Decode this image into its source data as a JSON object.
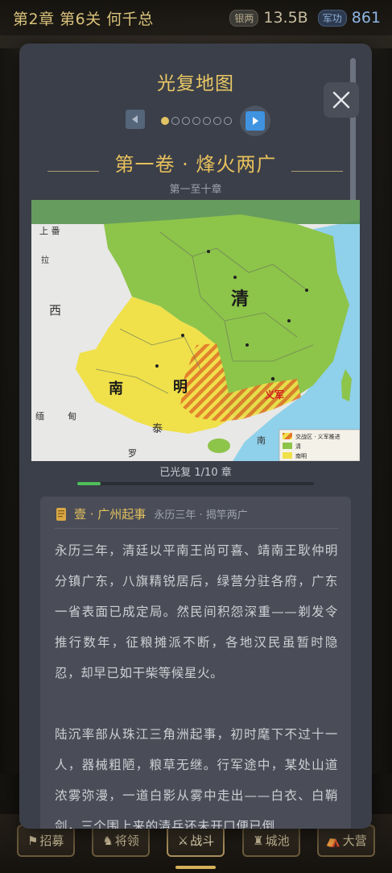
{
  "topbar": {
    "chapter": "第2章 第6关 何千总",
    "silver_label": "银两",
    "silver_value": "13.5B",
    "merit_label": "军功",
    "merit_value": "861"
  },
  "modal": {
    "title": "光复地图",
    "close_icon": "close-icon",
    "pager": {
      "total_pages": 7,
      "current_page": 1
    },
    "volume_title": "第一卷 · 烽火两广",
    "volume_subtitle": "第一至十章",
    "progress_label": "已光复 1/10 章",
    "progress_fraction": 0.1
  },
  "map": {
    "labels": {
      "qing": "清",
      "nan": "南",
      "ming": "明",
      "yijun": "义军",
      "tibet_up": "上",
      "tibet_zang": "番",
      "ladakh": "拉",
      "west": "西",
      "dian": "缅",
      "tian": "甸",
      "luo": "罗",
      "tai": "泰",
      "nanhai": "南"
    },
    "legend": [
      {
        "label": "交战区 · 义军推进",
        "color": "#e0772a"
      },
      {
        "label": "清",
        "color": "#8dc44a"
      },
      {
        "label": "南明",
        "color": "#f0e04a"
      }
    ]
  },
  "story": {
    "title": "壹 · 广州起事",
    "subtitle": "永历三年 · 揭竿两广",
    "para1": "永历三年，清廷以平南王尚可喜、靖南王耿仲明分镇广东，八旗精锐居后，绿营分驻各府，广东一省表面已成定局。然民间积怨深重——剃发令推行数年，征粮摊派不断，各地汉民虽暂时隐忍，却早已如干柴等候星火。",
    "para2": "陆沉率部从珠江三角洲起事，初时麾下不过十一人，器械粗陋，粮草无继。行军途中，某处山道浓雾弥漫，一道白影从雾中走出——白衣、白鞘剑，三个围上来的清兵还未开口便已倒"
  },
  "bottomnav": {
    "items": [
      {
        "label": "招募",
        "icon": "banner-icon"
      },
      {
        "label": "将领",
        "icon": "general-icon"
      },
      {
        "label": "战斗",
        "icon": "swords-icon"
      },
      {
        "label": "城池",
        "icon": "castle-icon"
      },
      {
        "label": "大营",
        "icon": "camp-icon"
      }
    ],
    "active": "战斗"
  }
}
